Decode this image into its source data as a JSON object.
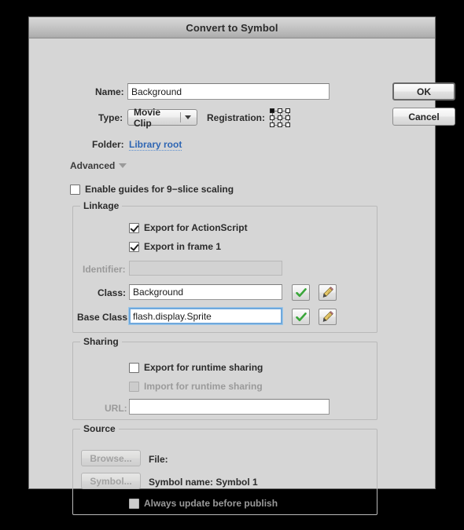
{
  "window": {
    "title": "Convert to Symbol"
  },
  "buttons": {
    "ok": "OK",
    "cancel": "Cancel",
    "browse": "Browse...",
    "symbol": "Symbol..."
  },
  "fields": {
    "name": {
      "label": "Name:",
      "value": "Background"
    },
    "type": {
      "label": "Type:",
      "value": "Movie Clip"
    },
    "registration": {
      "label": "Registration:",
      "selected": "top-left"
    },
    "folder": {
      "label": "Folder:",
      "value": "Library root"
    }
  },
  "advanced": {
    "label": "Advanced"
  },
  "nine_slice": {
    "label": "Enable guides for 9−slice scaling",
    "checked": false
  },
  "linkage": {
    "title": "Linkage",
    "export_actionscript": {
      "label": "Export for ActionScript",
      "checked": true
    },
    "export_frame1": {
      "label": "Export in frame 1",
      "checked": true
    },
    "identifier": {
      "label": "Identifier:",
      "value": "",
      "disabled": true
    },
    "class": {
      "label": "Class:",
      "value": "Background"
    },
    "base_class": {
      "label": "Base Class:",
      "value": "flash.display.Sprite"
    }
  },
  "sharing": {
    "title": "Sharing",
    "export_runtime": {
      "label": "Export for runtime sharing",
      "checked": false
    },
    "import_runtime": {
      "label": "Import for runtime sharing",
      "checked": false,
      "disabled": true
    },
    "url": {
      "label": "URL:",
      "value": ""
    }
  },
  "source": {
    "title": "Source",
    "file_label": "File:",
    "symbol_name_label": "Symbol name: Symbol 1",
    "always_update": {
      "label": "Always update before publish",
      "checked": false,
      "disabled": true
    }
  },
  "colors": {
    "dialog_bg": "#d6d6d6",
    "link": "#2f66b3",
    "focus_ring": "#6fa8dc",
    "check_green": "#3aa63a",
    "pencil_body": "#e8c96a"
  }
}
